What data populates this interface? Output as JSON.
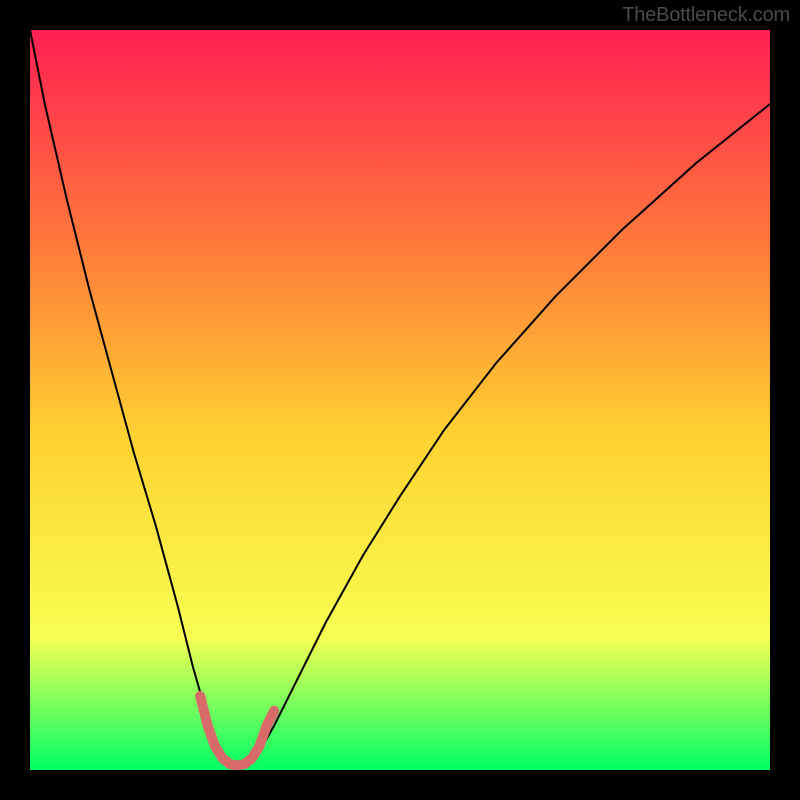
{
  "watermark": "TheBottleneck.com",
  "chart_data": {
    "type": "line",
    "title": "",
    "xlabel": "",
    "ylabel": "",
    "xlim": [
      0,
      100
    ],
    "ylim": [
      0,
      100
    ],
    "grid": false,
    "background_gradient": {
      "top": "#ff1f52",
      "upper_mid": "#ff7d3a",
      "mid": "#ffd231",
      "lower_mid": "#f7ff52",
      "bottom": "#00ff66"
    },
    "series": [
      {
        "name": "bottleneck-curve",
        "x": [
          0,
          2,
          5,
          8,
          11,
          14,
          17,
          20,
          22,
          24,
          25.5,
          27,
          28,
          29,
          30,
          31,
          33,
          36,
          40,
          45,
          50,
          56,
          63,
          71,
          80,
          90,
          100
        ],
        "y": [
          100,
          90,
          77,
          65,
          54,
          43,
          33,
          22,
          14,
          7,
          3,
          1,
          0.5,
          0.5,
          1,
          2.5,
          6,
          12,
          20,
          29,
          37,
          46,
          55,
          64,
          73,
          82,
          90
        ],
        "stroke": "#000000",
        "stroke_width": 2
      },
      {
        "name": "bottleneck-highlight",
        "x": [
          23,
          24,
          25,
          26,
          27,
          28,
          29,
          30,
          31,
          32,
          33
        ],
        "y": [
          10,
          6,
          3.2,
          1.6,
          0.8,
          0.6,
          0.8,
          1.6,
          3.2,
          6,
          8
        ],
        "stroke": "#d96a6a",
        "stroke_width": 10
      }
    ]
  }
}
